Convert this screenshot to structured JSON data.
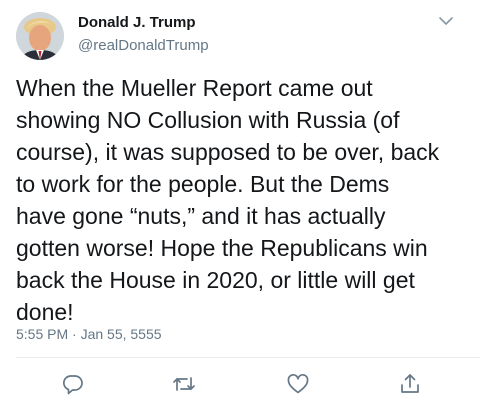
{
  "author": {
    "display_name": "Donald J. Trump",
    "handle": "@realDonaldTrump",
    "avatar_icon": "profile-photo"
  },
  "tweet": {
    "text": "When the Mueller Report came out\nshowing NO Collusion with Russia (of\ncourse), it was supposed to be over, back\nto work for the people. But the Dems\nhave gone “nuts,” and it has actually\ngotten worse! Hope the Republicans win\nback the House in 2020, or little will get\ndone!",
    "timestamp": "5:55 PM · Jan 55, 5555"
  },
  "actions": [
    {
      "name": "reply",
      "icon": "reply-icon"
    },
    {
      "name": "retweet",
      "icon": "retweet-icon"
    },
    {
      "name": "like",
      "icon": "heart-icon"
    },
    {
      "name": "share",
      "icon": "share-icon"
    }
  ],
  "colors": {
    "text": "#14171a",
    "secondary": "#657786",
    "icon": "#657786",
    "divider": "#e6ecf0"
  }
}
